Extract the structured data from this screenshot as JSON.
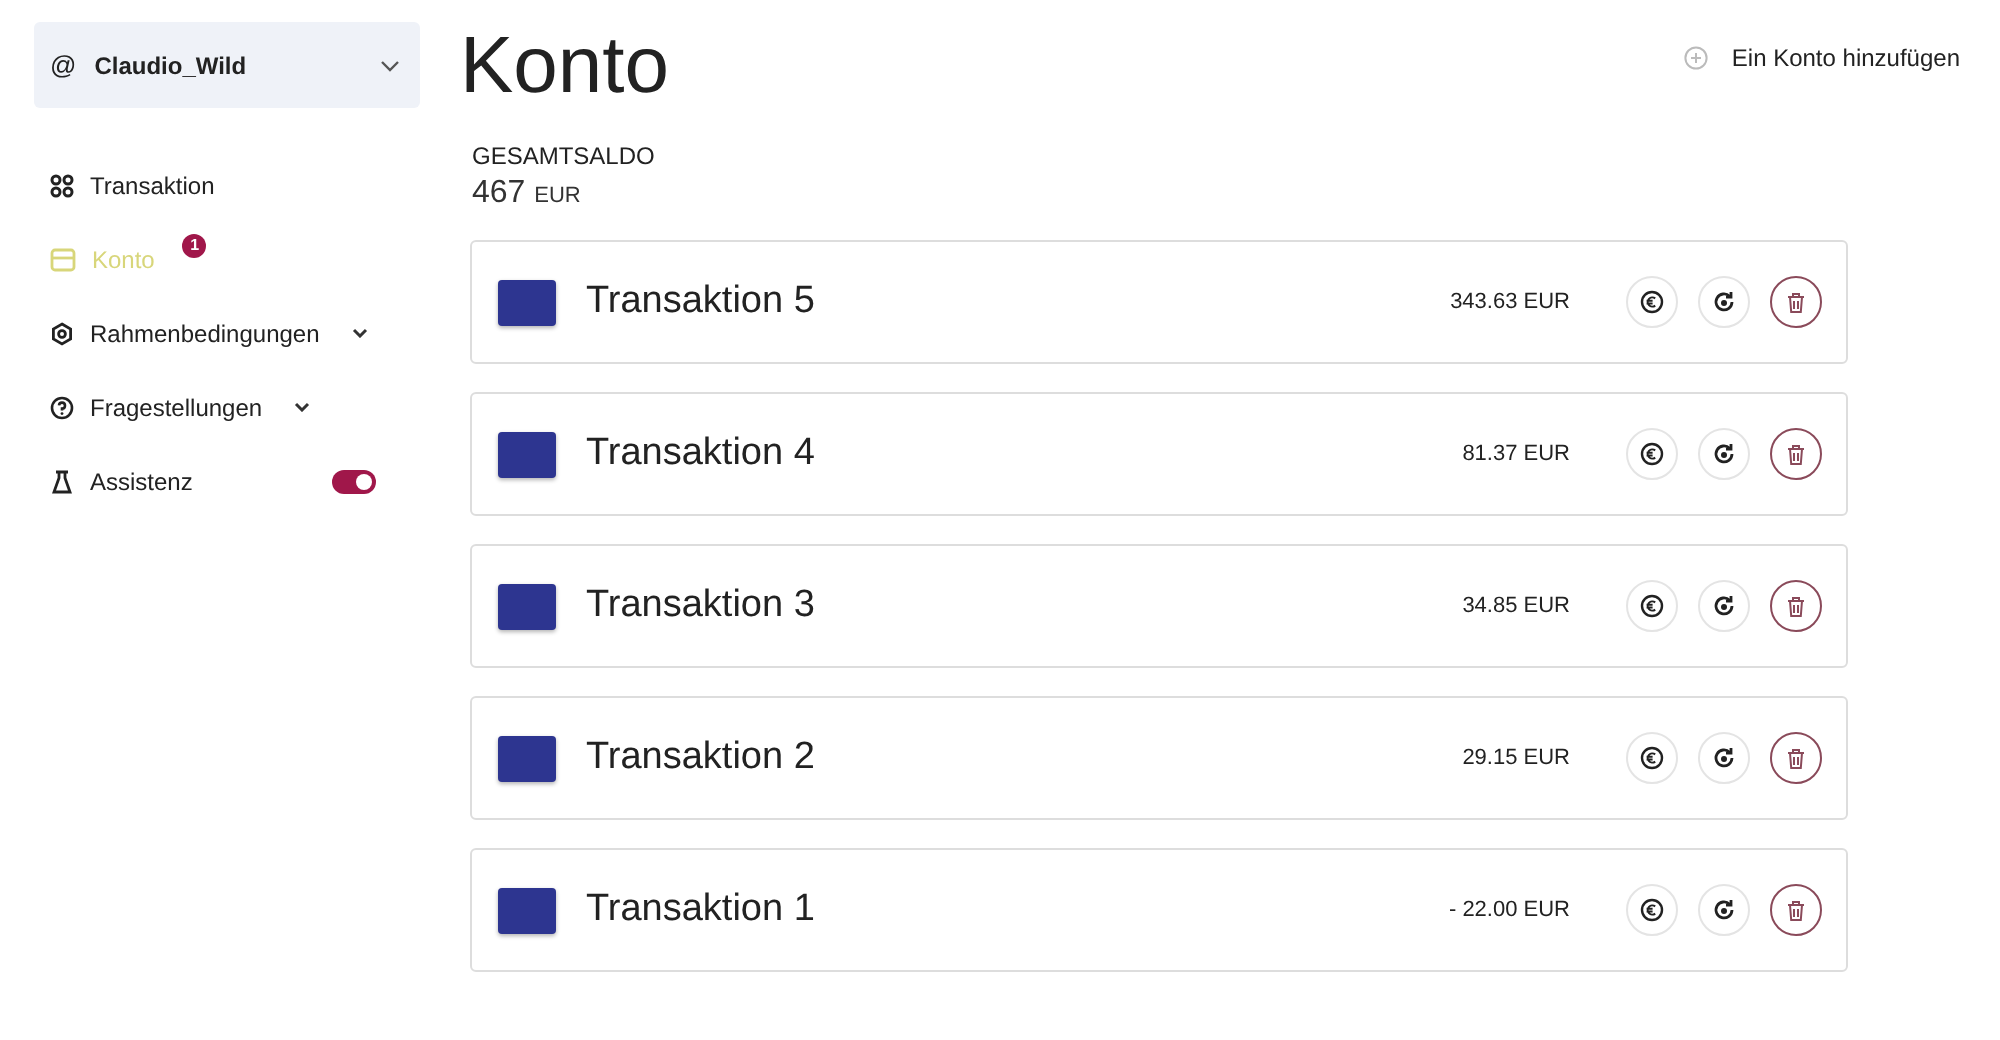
{
  "account": {
    "symbol": "@",
    "name": "Claudio_Wild"
  },
  "nav": [
    {
      "label": "Transaktion",
      "kind": "link",
      "selected": false
    },
    {
      "label": "Konto",
      "kind": "link",
      "selected": true,
      "badge": "1"
    },
    {
      "label": "Rahmenbedingungen",
      "kind": "group",
      "selected": false,
      "expanded": false
    },
    {
      "label": "Fragestellungen",
      "kind": "group",
      "selected": false,
      "expanded": false
    },
    {
      "label": "Assistenz",
      "kind": "toggle",
      "selected": false,
      "on": true
    }
  ],
  "page": {
    "title": "Konto",
    "add_action": "Ein Konto hinzufügen",
    "total_label": "GESAMTSALDO",
    "total_value": "467",
    "total_currency": "EUR"
  },
  "transactions": [
    {
      "name": "Transaktion 5",
      "amount": "343.63 EUR"
    },
    {
      "name": "Transaktion 4",
      "amount": "81.37 EUR"
    },
    {
      "name": "Transaktion 3",
      "amount": "34.85 EUR"
    },
    {
      "name": "Transaktion 2",
      "amount": "29.15 EUR"
    },
    {
      "name": "Transaktion 1",
      "amount": "- 22.00 EUR"
    }
  ]
}
